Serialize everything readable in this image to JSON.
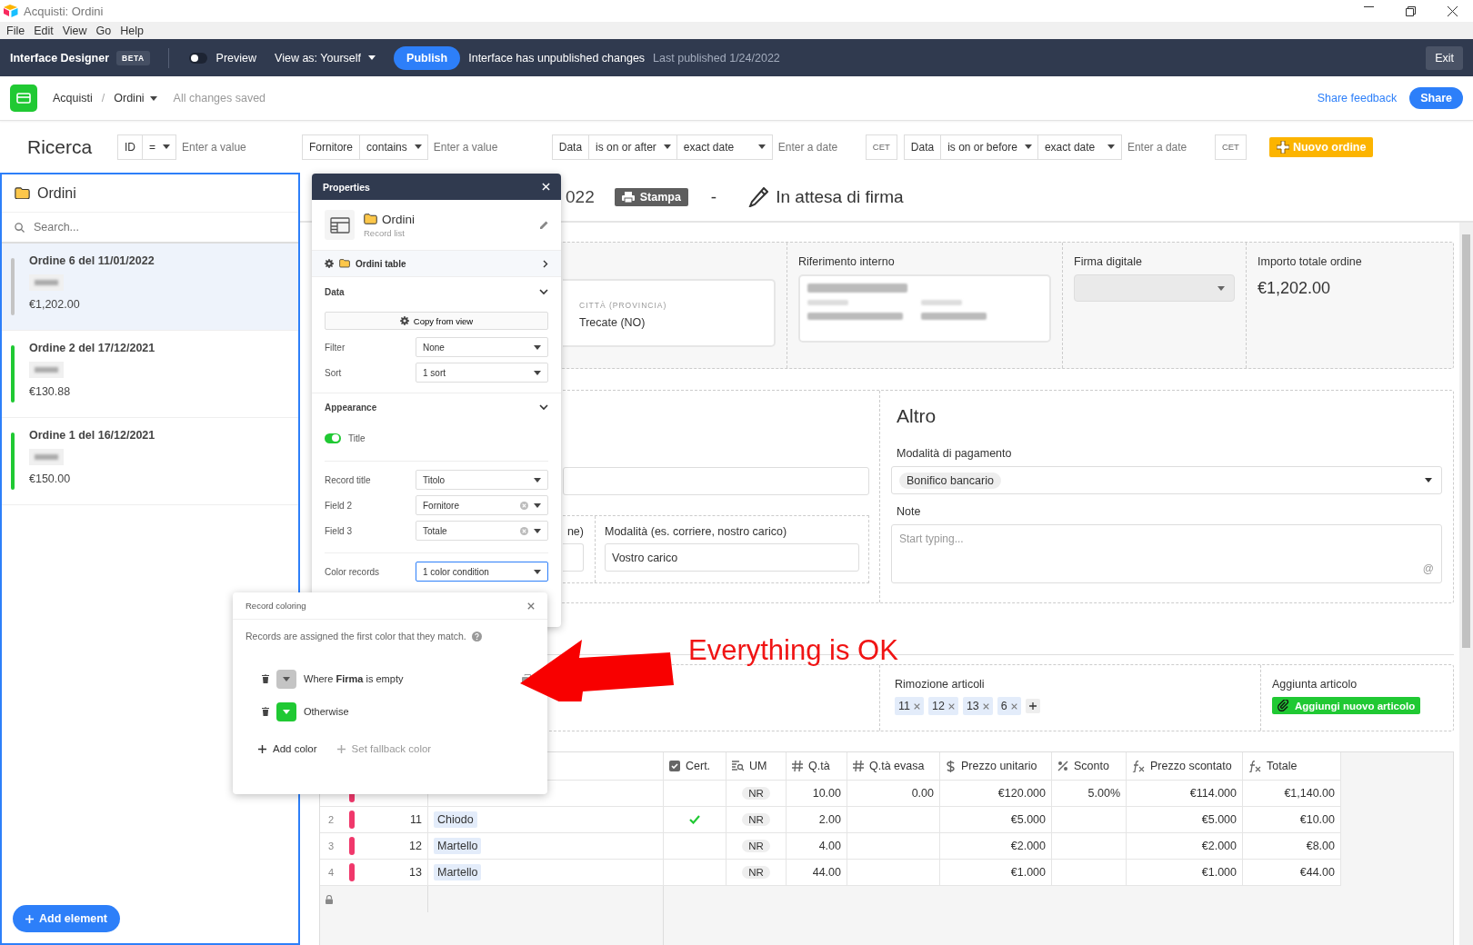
{
  "window": {
    "title": "Acquisti: Ordini"
  },
  "menu": [
    "File",
    "Edit",
    "View",
    "Go",
    "Help"
  ],
  "designer_bar": {
    "title": "Interface Designer",
    "badge": "BETA",
    "preview": {
      "label": "Preview",
      "on": false
    },
    "view_as": "View as: Yourself",
    "publish": "Publish",
    "status": "Interface has unpublished changes",
    "last_published": "Last published 1/24/2022",
    "exit": "Exit"
  },
  "breadcrumb": {
    "base": "Acquisti",
    "separator": "/",
    "page": "Ordini",
    "saved": "All changes saved",
    "feedback": "Share feedback",
    "share": "Share"
  },
  "search_bar": {
    "title": "Ricerca",
    "new_button": "Nuovo ordine",
    "filters": [
      {
        "field": "ID",
        "operator": "=",
        "placeholder": "Enter a value"
      },
      {
        "field": "Fornitore",
        "operator": "contains",
        "placeholder": "Enter a value"
      },
      {
        "field": "Data",
        "operator": "is on or after",
        "mode": "exact date",
        "placeholder": "Enter a date",
        "tz": "CET"
      },
      {
        "field": "Data",
        "operator": "is on or before",
        "mode": "exact date",
        "placeholder": "Enter a date",
        "tz": "CET"
      }
    ]
  },
  "record_list": {
    "title": "Ordini",
    "search_placeholder": "Search...",
    "add_element": "Add element",
    "records": [
      {
        "title": "Ordine 6 del 11/01/2022",
        "amount": "€1,202.00",
        "color": "#c4c4c4",
        "selected": true
      },
      {
        "title": "Ordine 2 del 17/12/2021",
        "amount": "€130.88",
        "color": "#20c933",
        "selected": false
      },
      {
        "title": "Ordine 1 del 16/12/2021",
        "amount": "€150.00",
        "color": "#20c933",
        "selected": false
      }
    ]
  },
  "record_header": {
    "title_fragment": "022",
    "print": "Stampa",
    "separator": "-",
    "status": "In attesa di firma"
  },
  "summary": {
    "city_label": "CITTÀ (PROVINCIA)",
    "city": "Trecate (NO)",
    "reference_label": "Riferimento interno",
    "signature_label": "Firma digitale",
    "total_label": "Importo totale ordine",
    "total": "€1,202.00"
  },
  "details": {
    "shipping_fragment_label": "ne)",
    "shipping_mode_label": "Modalità (es. corriere, nostro carico)",
    "shipping_mode": "Vostro carico",
    "other_title": "Altro",
    "payment_label": "Modalità di pagamento",
    "payment": "Bonifico bancario",
    "note_label": "Note",
    "note_placeholder": "Start typing...",
    "mention": "@"
  },
  "articles": {
    "remove_label": "Rimozione articoli",
    "remove_tags": [
      "11",
      "12",
      "13",
      "6"
    ],
    "add_label": "Aggiunta articolo",
    "add_button": "Aggiungi nuovo articolo"
  },
  "table": {
    "columns": [
      {
        "label": "Cert.",
        "kind": "checkbox"
      },
      {
        "label": "UM",
        "kind": "lookup"
      },
      {
        "label": "Q.tà",
        "kind": "number"
      },
      {
        "label": "Q.tà evasa",
        "kind": "number"
      },
      {
        "label": "Prezzo unitario",
        "kind": "currency"
      },
      {
        "label": "Sconto",
        "kind": "percent"
      },
      {
        "label": "Prezzo scontato",
        "kind": "formula"
      },
      {
        "label": "Totale",
        "kind": "formula"
      }
    ],
    "rows": [
      {
        "color": "#f0386b",
        "cert": false,
        "um": "NR",
        "qta": "10.00",
        "qta_evasa": "0.00",
        "unit_price": "€120.000",
        "discount": "5.00%",
        "discounted_price": "€114.000",
        "total": "€1,140.00"
      },
      {
        "index": "2",
        "id": "11",
        "name": "Chiodo",
        "color": "#f0386b",
        "cert": true,
        "um": "NR",
        "qta": "2.00",
        "unit_price": "€5.000",
        "discounted_price": "€5.000",
        "total": "€10.00"
      },
      {
        "index": "3",
        "id": "12",
        "name": "Martello",
        "color": "#f0386b",
        "cert": false,
        "um": "NR",
        "qta": "4.00",
        "unit_price": "€2.000",
        "discounted_price": "€2.000",
        "total": "€8.00"
      },
      {
        "index": "4",
        "id": "13",
        "name": "Martello",
        "color": "#f0386b",
        "cert": false,
        "um": "NR",
        "qta": "44.00",
        "unit_price": "€1.000",
        "discounted_price": "€1.000",
        "total": "€44.00"
      }
    ]
  },
  "properties": {
    "title": "Properties",
    "element_name": "Ordini",
    "element_type": "Record list",
    "source": "Ordini table",
    "data": {
      "title": "Data",
      "copy_button": "Copy from view",
      "rows": [
        {
          "label": "Filter",
          "value": "None"
        },
        {
          "label": "Sort",
          "value": "1 sort"
        }
      ]
    },
    "appearance": {
      "title": "Appearance",
      "title_toggle": {
        "label": "Title",
        "on": true
      },
      "fields": [
        {
          "label": "Record title",
          "value": "Titolo",
          "clearable": false
        },
        {
          "label": "Field 2",
          "value": "Fornitore",
          "clearable": true
        },
        {
          "label": "Field 3",
          "value": "Totale",
          "clearable": true
        }
      ],
      "color_label": "Color records",
      "color_value": "1 color condition"
    }
  },
  "record_coloring": {
    "title": "Record coloring",
    "hint": "Records are assigned the first color that they match.",
    "conditions": [
      {
        "text": "Where **Firma** is empty",
        "color": "#c4c4c4",
        "hovered": true
      },
      {
        "text": "Otherwise",
        "color": "#20c933",
        "hovered": false
      }
    ],
    "add": "Add color",
    "fallback": "Set fallback color"
  },
  "annotation": {
    "text": "Everything is OK"
  }
}
